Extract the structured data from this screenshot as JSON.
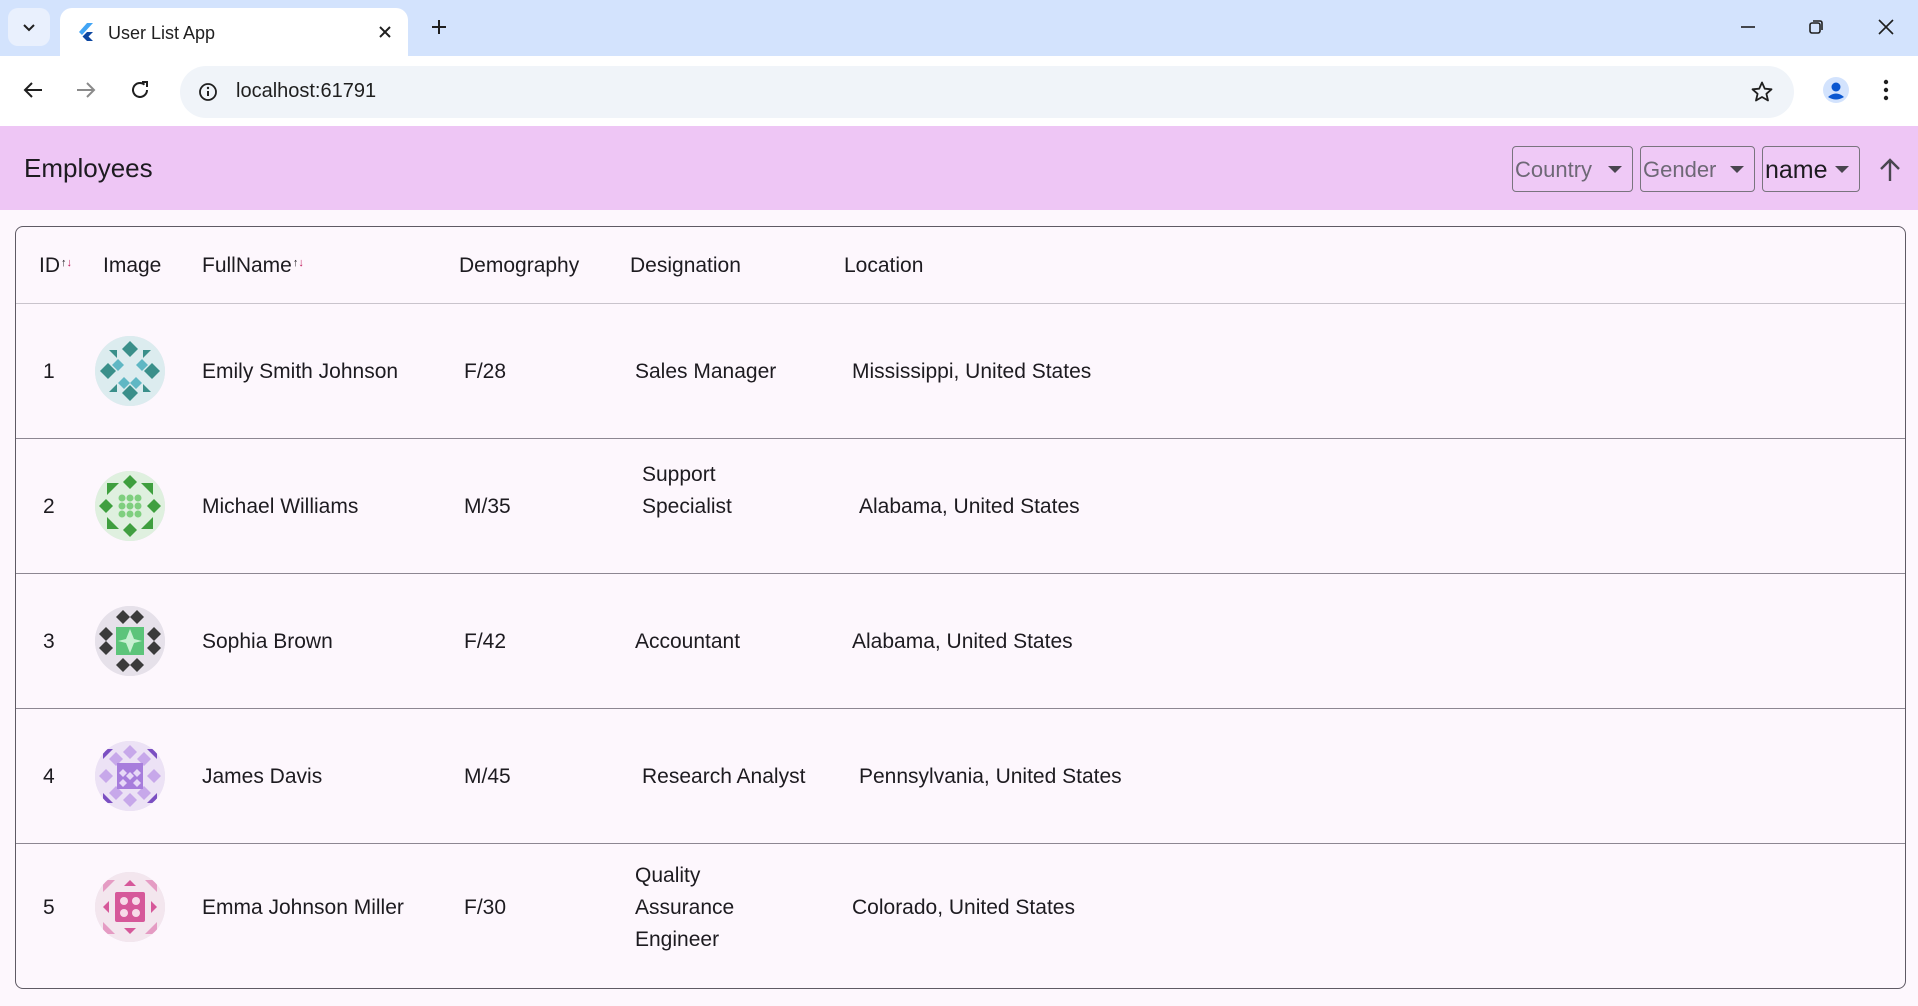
{
  "browser": {
    "tab_title": "User List App",
    "url": "localhost:61791"
  },
  "app": {
    "title": "Employees",
    "filters": {
      "country_label": "Country",
      "gender_label": "Gender",
      "sort_label": "name"
    }
  },
  "table": {
    "headers": {
      "id": "ID",
      "image": "Image",
      "fullname": "FullName",
      "demography": "Demography",
      "designation": "Designation",
      "location": "Location"
    },
    "sort_arrows": {
      "up": "↑",
      "down": "↓"
    },
    "rows": [
      {
        "id": "1",
        "fullname": "Emily Smith Johnson",
        "demography": "F/28",
        "designation": "Sales Manager",
        "location": "Mississippi, United States",
        "avatar_color": "#3a8f8a"
      },
      {
        "id": "2",
        "fullname": "Michael  Williams",
        "demography": "M/35",
        "designation": "Support Specialist",
        "location": "Alabama, United States",
        "avatar_color": "#3f9f3f"
      },
      {
        "id": "3",
        "fullname": "Sophia  Brown",
        "demography": "F/42",
        "designation": "Accountant",
        "location": "Alabama, United States",
        "avatar_color": "#3b3b3b"
      },
      {
        "id": "4",
        "fullname": "James  Davis",
        "demography": "M/45",
        "designation": "Research Analyst",
        "location": "Pennsylvania, United States",
        "avatar_color": "#7b4fc2"
      },
      {
        "id": "5",
        "fullname": "Emma Johnson Miller",
        "demography": "F/30",
        "designation": "Quality Assurance Engineer",
        "location": "Colorado, United States",
        "avatar_color": "#d6589a"
      }
    ]
  }
}
